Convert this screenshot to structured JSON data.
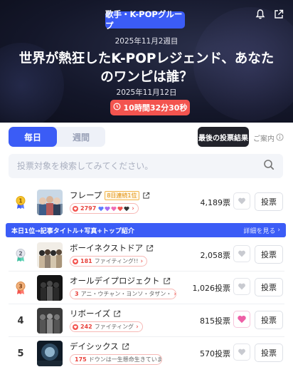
{
  "hero": {
    "category": "歌手・K-POPグループ",
    "week": "2025年11月2週目",
    "title": "世界が熱狂したK-POPレジェンド、あなたのワンピは誰？",
    "date": "2025年11月12日",
    "countdown": "10時間32分30秒",
    "icons": [
      "bell-icon",
      "share-icon"
    ]
  },
  "tabs": [
    {
      "label": "毎日",
      "active": true
    },
    {
      "label": "週間",
      "active": false
    }
  ],
  "last_result_label": "最後の投票結果",
  "guide_label": "ご案内",
  "search": {
    "placeholder": "投票対象を検索してみてください。"
  },
  "promo": {
    "text": "本日1位→記事タイトル+写真+トップ紹介",
    "more": "詳細を見る"
  },
  "colors": {
    "accent": "#3b5cf6",
    "countdown": "#f3544f",
    "dark_button": "#22232b",
    "pill_border": "#f7b9b6"
  },
  "rows": [
    {
      "rank": "1",
      "name": "フレープ",
      "badge": "8日連続1位",
      "fan_count": "2797",
      "fan_text": "",
      "votes": "4,189票",
      "vote_label": "投票",
      "liked": false,
      "medal": "gold"
    },
    {
      "rank": "2",
      "name": "ボーイネクストドア",
      "fan_count": "181",
      "fan_text": "ファイティング!!",
      "votes": "2,058票",
      "vote_label": "投票",
      "liked": false,
      "medal": "silver"
    },
    {
      "rank": "3",
      "name": "オールデイプロジェクト",
      "fan_count": "3",
      "fan_text": "アニ・ウチャン・ヨンソ・タザン・",
      "votes": "1,026投票",
      "vote_label": "投票",
      "liked": false,
      "medal": "bronze"
    },
    {
      "rank": "4",
      "name": "リボーイズ",
      "fan_count": "242",
      "fan_text": "ファイティング",
      "votes": "815投票",
      "vote_label": "投票",
      "liked": true,
      "medal": ""
    },
    {
      "rank": "5",
      "name": "デイシックス",
      "fan_count": "175",
      "fan_text": "ドウンは一生懸命生きていま",
      "votes": "570投票",
      "vote_label": "投票",
      "liked": false,
      "medal": ""
    }
  ]
}
